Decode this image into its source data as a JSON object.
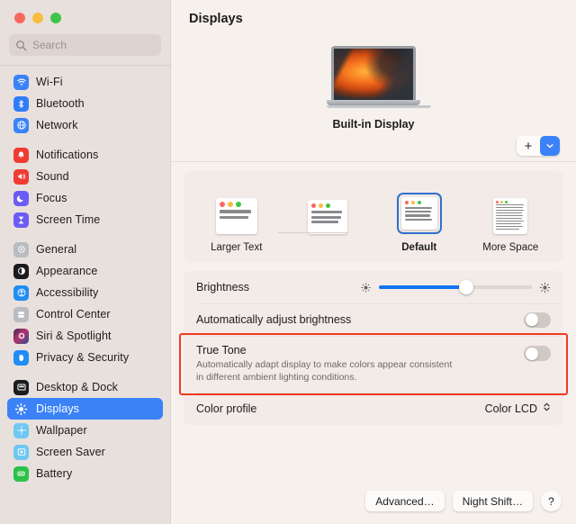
{
  "window": {
    "traffic_lights": [
      "close",
      "minimize",
      "zoom"
    ]
  },
  "search": {
    "placeholder": "Search",
    "value": "",
    "icon": "search-icon"
  },
  "sidebar": {
    "groups": [
      {
        "items": [
          {
            "label": "Wi-Fi",
            "icon": "wifi-icon",
            "color": "#3b82f7",
            "selected": false
          },
          {
            "label": "Bluetooth",
            "icon": "bluetooth-icon",
            "color": "#2f7cf6",
            "selected": false
          },
          {
            "label": "Network",
            "icon": "globe-icon",
            "color": "#3b82f7",
            "selected": false
          }
        ]
      },
      {
        "items": [
          {
            "label": "Notifications",
            "icon": "bell-icon",
            "color": "#ef3c33",
            "selected": false
          },
          {
            "label": "Sound",
            "icon": "speaker-icon",
            "color": "#ef3c33",
            "selected": false
          },
          {
            "label": "Focus",
            "icon": "moon-icon",
            "color": "#6b5cf6",
            "selected": false
          },
          {
            "label": "Screen Time",
            "icon": "hourglass-icon",
            "color": "#6b5cf6",
            "selected": false
          }
        ]
      },
      {
        "items": [
          {
            "label": "General",
            "icon": "gear-icon",
            "color": "#9b9ea3",
            "selected": false
          },
          {
            "label": "Appearance",
            "icon": "contrast-icon",
            "color": "#1c1c1e",
            "selected": false
          },
          {
            "label": "Accessibility",
            "icon": "accessibility-icon",
            "color": "#1f8df5",
            "selected": false
          },
          {
            "label": "Control Center",
            "icon": "control-center-icon",
            "color": "#9b9ea3",
            "selected": false
          },
          {
            "label": "Siri & Spotlight",
            "icon": "siri-icon",
            "color": "#2b2b33",
            "selected": false
          },
          {
            "label": "Privacy & Security",
            "icon": "hand-icon",
            "color": "#1f8df5",
            "selected": false
          }
        ]
      },
      {
        "items": [
          {
            "label": "Desktop & Dock",
            "icon": "desktop-dock-icon",
            "color": "#1c1c1e",
            "selected": false
          },
          {
            "label": "Displays",
            "icon": "brightness-icon",
            "color": "#3b82f7",
            "selected": true
          },
          {
            "label": "Wallpaper",
            "icon": "wallpaper-icon",
            "color": "#6fc8f2",
            "selected": false
          },
          {
            "label": "Screen Saver",
            "icon": "screensaver-icon",
            "color": "#6fc8f2",
            "selected": false
          },
          {
            "label": "Battery",
            "icon": "battery-icon",
            "color": "#2bc24a",
            "selected": false
          }
        ]
      }
    ]
  },
  "main": {
    "title": "Displays",
    "display": {
      "name": "Built-in Display",
      "add_button": {
        "plus_label": "+",
        "chevron_icon": "chevron-down-icon"
      }
    },
    "resolution": {
      "options": [
        {
          "label": "Larger Text",
          "selected": false
        },
        {
          "label": "",
          "selected": false
        },
        {
          "label": "Default",
          "selected": true
        },
        {
          "label": "More Space",
          "selected": false
        }
      ]
    },
    "settings": {
      "brightness": {
        "label": "Brightness",
        "value_percent": 57,
        "low_icon": "brightness-low-icon",
        "high_icon": "brightness-high-icon"
      },
      "auto_brightness": {
        "label": "Automatically adjust brightness",
        "enabled": false
      },
      "true_tone": {
        "label": "True Tone",
        "description": "Automatically adapt display to make colors appear consistent in different ambient lighting conditions.",
        "enabled": false,
        "highlighted": true,
        "highlight_color": "#f03a20"
      },
      "color_profile": {
        "label": "Color profile",
        "value": "Color LCD",
        "icon": "updown-chevron-icon"
      }
    },
    "footer": {
      "advanced_label": "Advanced…",
      "night_shift_label": "Night Shift…",
      "help_label": "?"
    }
  }
}
